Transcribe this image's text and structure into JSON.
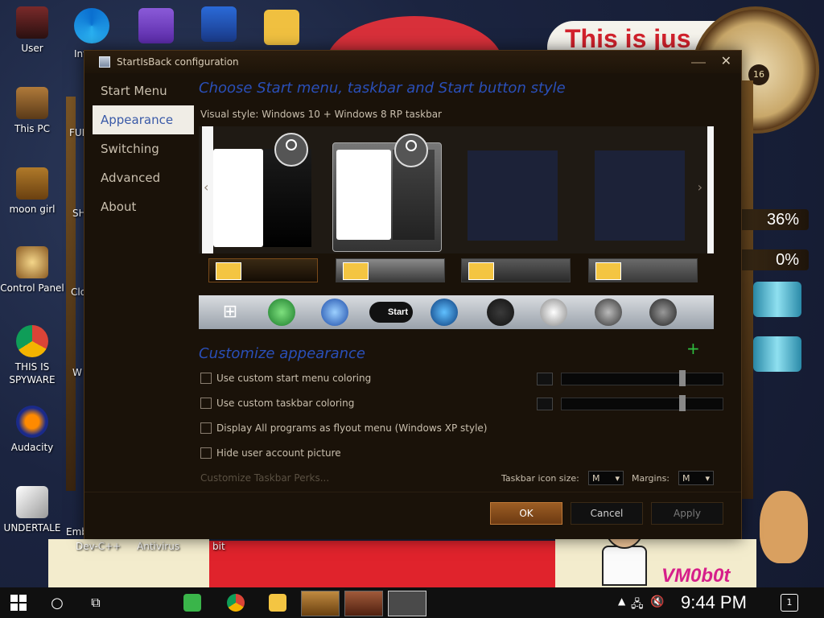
{
  "desktop": {
    "speech_text": "This is jus",
    "gauges": [
      "36%",
      "0%"
    ],
    "watermark": "VM0b0t",
    "clock_number": "16",
    "icons": [
      {
        "label": "User",
        "name": "user-folder-icon"
      },
      {
        "label": "This PC",
        "name": "this-pc-icon"
      },
      {
        "label": "moon girl",
        "name": "moon-girl-icon"
      },
      {
        "label": "Control Panel",
        "name": "control-panel-icon"
      },
      {
        "label": "THIS IS SPYWARE",
        "name": "chrome-icon"
      },
      {
        "label": "Audacity",
        "name": "audacity-icon"
      },
      {
        "label": "UNDERTALE",
        "name": "unity-icon"
      }
    ],
    "partial_labels": [
      "Int Ex",
      "FUR",
      "SH HO",
      "Clo",
      "W Wi",
      "Emb",
      "Dev-C++",
      "Antivirus",
      "bit"
    ]
  },
  "window": {
    "title": "StartIsBack configuration",
    "nav": [
      "Start Menu",
      "Appearance",
      "Switching",
      "Advanced",
      "About"
    ],
    "active_nav": "Appearance",
    "heading_style": "Choose Start menu, taskbar and Start button style",
    "visual_style": "Visual style:  Windows 10 + Windows 8 RP taskbar",
    "start_pill": "Start",
    "heading_custom": "Customize appearance",
    "options": [
      {
        "label": "Use custom start menu coloring",
        "checked": false
      },
      {
        "label": "Use custom taskbar coloring",
        "checked": false
      },
      {
        "label": "Display All programs as flyout menu (Windows XP style)",
        "checked": false
      },
      {
        "label": "Hide user account picture",
        "checked": false
      }
    ],
    "perks_link": "Customize Taskbar Perks...",
    "icon_size_label": "Taskbar icon size:",
    "icon_size_value": "M",
    "margins_label": "Margins:",
    "margins_value": "M",
    "buttons": {
      "ok": "OK",
      "cancel": "Cancel",
      "apply": "Apply"
    }
  },
  "taskbar": {
    "time": "9:44 PM",
    "notifications": "1"
  },
  "colors": {
    "accent_heading": "#2a4fb8",
    "ok_button": "#9c5d24",
    "window_bg": "#1a1209"
  }
}
